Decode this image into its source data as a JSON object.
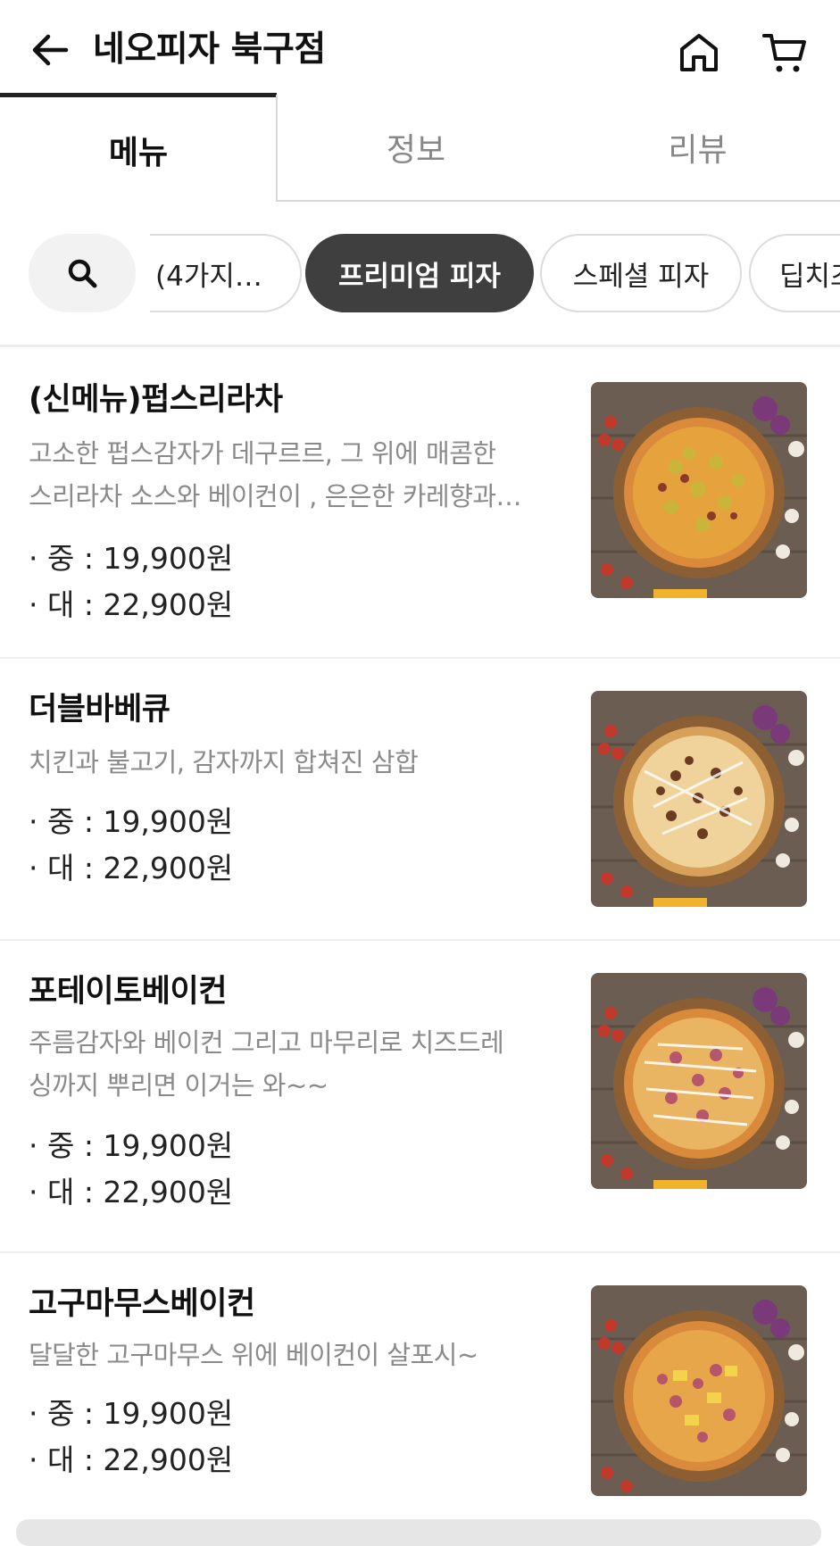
{
  "header": {
    "title": "네오피자 북구점",
    "back_icon": "arrow-left-icon",
    "home_icon": "home-icon",
    "cart_icon": "cart-icon"
  },
  "tabs": [
    {
      "label": "메뉴",
      "active": true
    },
    {
      "label": "정보",
      "active": false
    },
    {
      "label": "리뷰",
      "active": false
    }
  ],
  "chips": [
    {
      "label": "(4가지…",
      "active": false
    },
    {
      "label": "프리미엄 피자",
      "active": true
    },
    {
      "label": "스페셜 피자",
      "active": false
    },
    {
      "label": "딥치즈",
      "active": false
    }
  ],
  "colors": {
    "active_chip_bg": "#3f3f3f",
    "description": "#8a8a8a",
    "divider": "#efefef"
  },
  "menu": [
    {
      "name": "(신메뉴)펍스리라차",
      "desc1": "고소한 펍스감자가 데구르르, 그 위에 매콤한",
      "desc2": "스리라차 소스와 베이컨이 , 은은한 카레향과…",
      "price_medium": "· 중 : 19,900원",
      "price_large": "· 대 : 22,900원"
    },
    {
      "name": "더블바베큐",
      "desc1": "치킨과 불고기, 감자까지 합쳐진 삼합",
      "desc2": "",
      "price_medium": "· 중 : 19,900원",
      "price_large": "· 대 : 22,900원"
    },
    {
      "name": "포테이토베이컨",
      "desc1": "주름감자와 베이컨  그리고 마무리로 치즈드레",
      "desc2": "싱까지 뿌리면 이거는 와~~",
      "price_medium": "· 중 : 19,900원",
      "price_large": "· 대 : 22,900원"
    },
    {
      "name": "고구마무스베이컨",
      "desc1": "달달한 고구마무스 위에 베이컨이 살포시~",
      "desc2": "",
      "price_medium": "· 중 : 19,900원",
      "price_large": "· 대 : 22,900원"
    }
  ]
}
